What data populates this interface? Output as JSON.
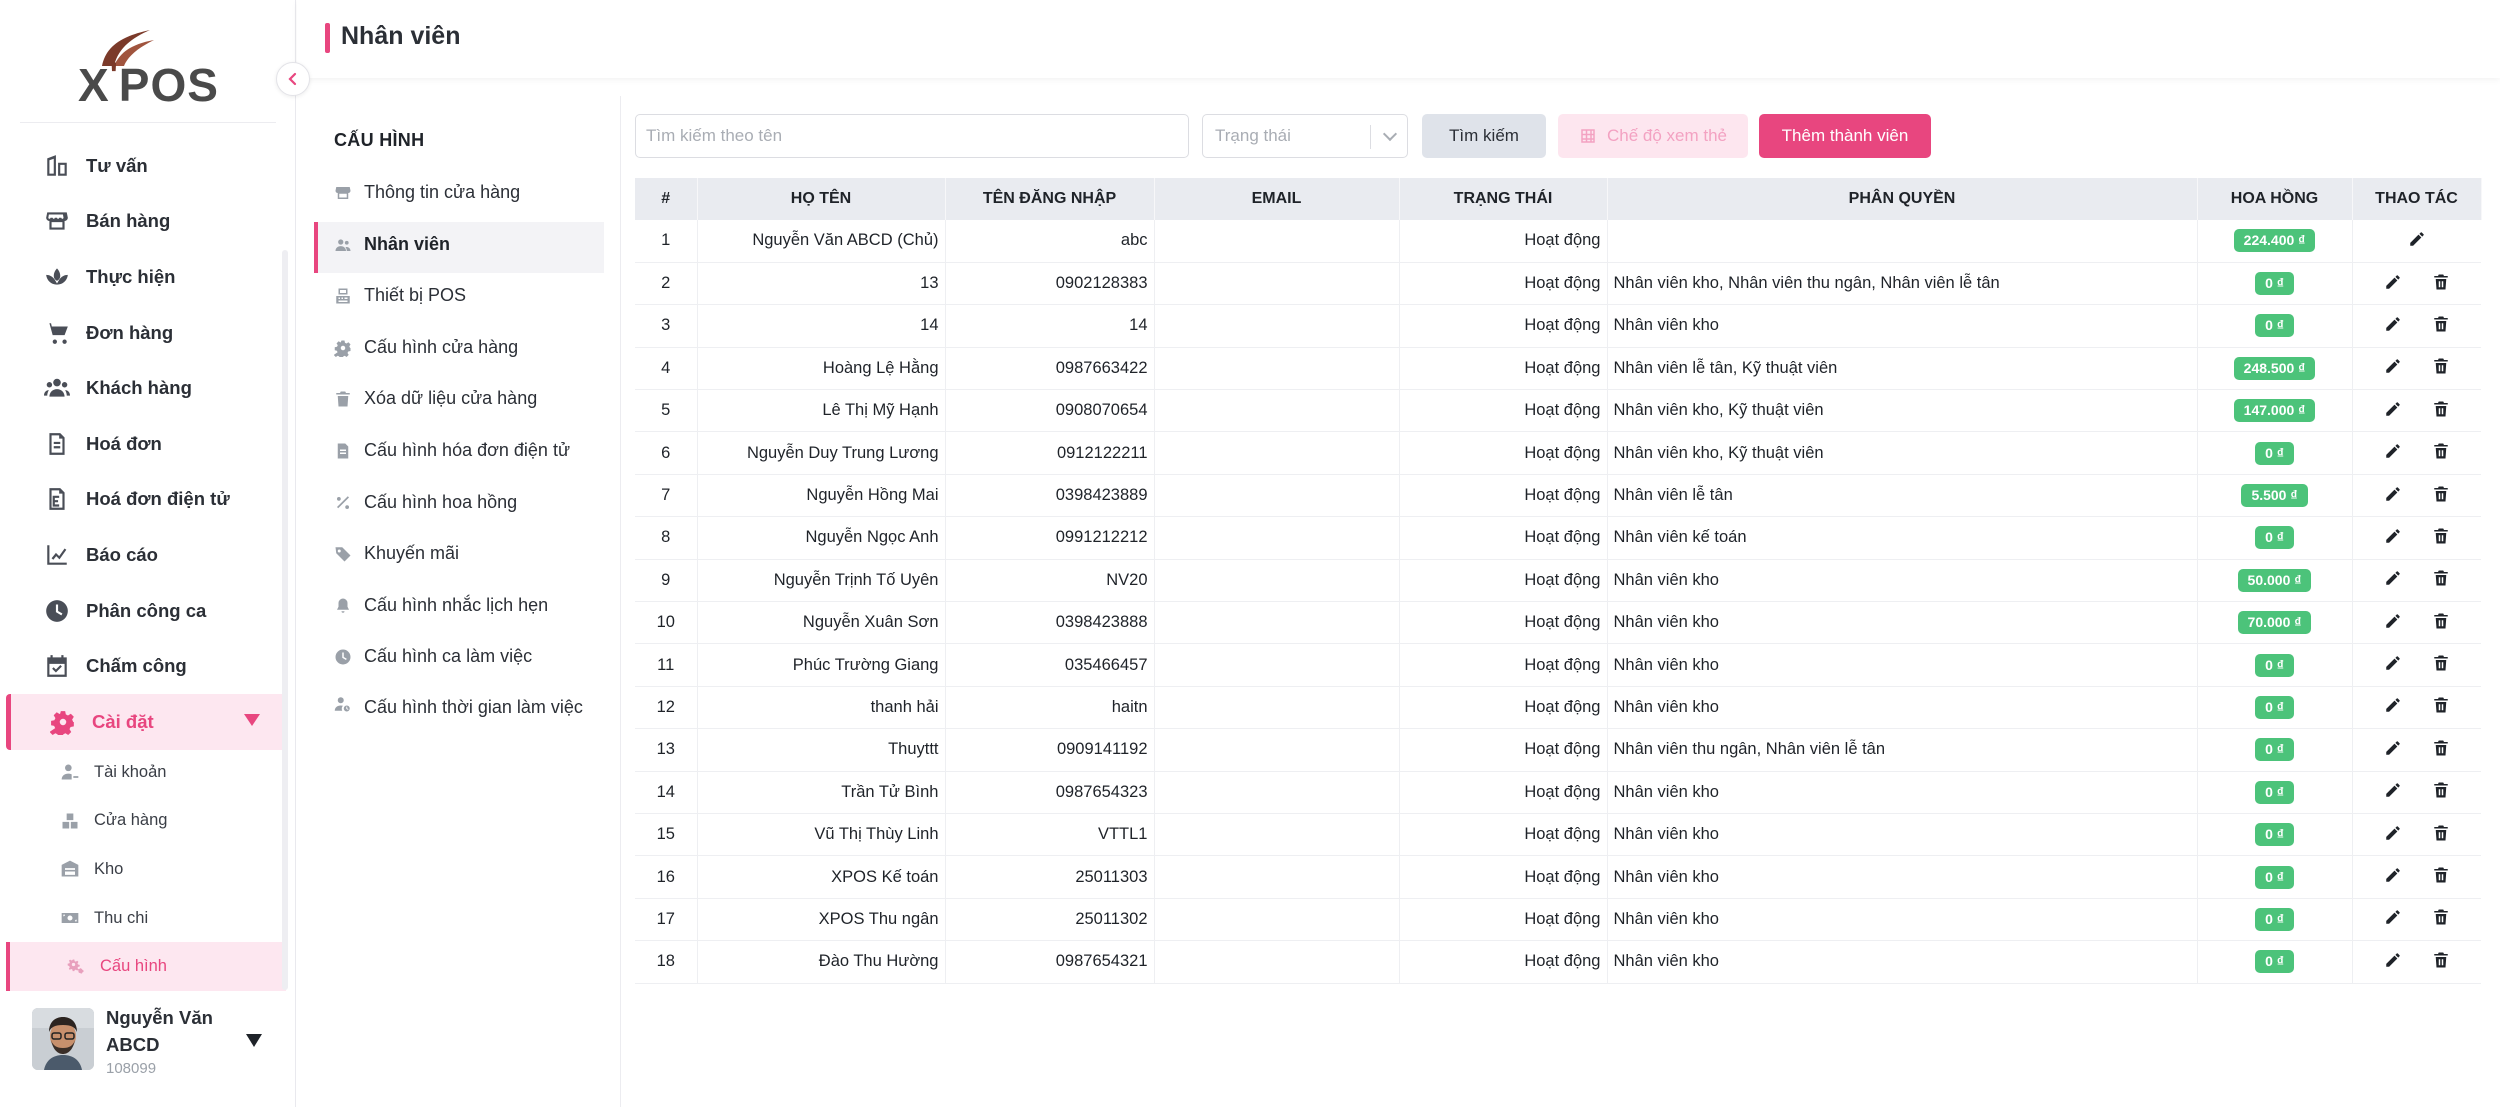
{
  "brand": {
    "name": "X'POS",
    "letter": "X",
    "apostrophe": "'",
    "rest": "POS"
  },
  "header": {
    "title": "Nhân viên"
  },
  "sidebar": {
    "items": [
      {
        "label": "Tư vấn",
        "icon": "consult-icon"
      },
      {
        "label": "Bán hàng",
        "icon": "store-icon"
      },
      {
        "label": "Thực hiện",
        "icon": "lotus-icon"
      },
      {
        "label": "Đơn hàng",
        "icon": "cart-icon"
      },
      {
        "label": "Khách hàng",
        "icon": "users-icon"
      },
      {
        "label": "Hoá đơn",
        "icon": "invoice-icon"
      },
      {
        "label": "Hoá đơn điện tử",
        "icon": "e-invoice-icon"
      },
      {
        "label": "Báo cáo",
        "icon": "chart-icon"
      },
      {
        "label": "Phân công ca",
        "icon": "clock-icon"
      },
      {
        "label": "Chấm công",
        "icon": "calendar-check-icon"
      },
      {
        "label": "Cài đặt",
        "icon": "gear-icon"
      }
    ],
    "sub_items": [
      {
        "label": "Tài khoản",
        "icon": "account-icon"
      },
      {
        "label": "Cửa hàng",
        "icon": "shop-icon"
      },
      {
        "label": "Kho",
        "icon": "warehouse-icon"
      },
      {
        "label": "Thu chi",
        "icon": "money-icon"
      },
      {
        "label": "Cấu hình",
        "icon": "cogs-icon"
      }
    ],
    "active_item": "Cài đặt",
    "active_sub_item": "Cấu hình"
  },
  "user": {
    "name": "Nguyễn Văn ABCD",
    "code": "108099"
  },
  "config": {
    "title": "CẤU HÌNH",
    "items": [
      {
        "label": "Thông tin cửa hàng",
        "icon": "store-info-icon"
      },
      {
        "label": "Nhân viên",
        "icon": "staff-icon"
      },
      {
        "label": "Thiết bị POS",
        "icon": "pos-device-icon"
      },
      {
        "label": "Cấu hình cửa hàng",
        "icon": "gear-icon"
      },
      {
        "label": "Xóa dữ liệu cửa hàng",
        "icon": "trash-icon"
      },
      {
        "label": "Cấu hình hóa đơn điện tử",
        "icon": "document-icon"
      },
      {
        "label": "Cấu hình hoa hồng",
        "icon": "percent-icon"
      },
      {
        "label": "Khuyến mãi",
        "icon": "tag-icon"
      },
      {
        "label": "Cấu hình nhắc lịch hẹn",
        "icon": "bell-icon"
      },
      {
        "label": "Cấu hình ca làm việc",
        "icon": "clock-icon"
      },
      {
        "label": "Cấu hình thời gian làm việc",
        "icon": "user-clock-icon"
      }
    ],
    "active": "Nhân viên"
  },
  "toolbar": {
    "search_placeholder": "Tìm kiếm theo tên",
    "status_placeholder": "Trạng thái",
    "search_button": "Tìm kiếm",
    "card_view_button": "Chế độ xem thẻ",
    "add_button": "Thêm thành viên"
  },
  "table": {
    "columns": [
      "#",
      "HỌ TÊN",
      "TÊN ĐĂNG NHẬP",
      "EMAIL",
      "TRẠNG THÁI",
      "PHÂN QUYỀN",
      "HOA HỒNG",
      "THAO TÁC"
    ],
    "rows": [
      {
        "idx": "1",
        "name": "Nguyễn Văn ABCD (Chủ)",
        "username": "abc",
        "email": "",
        "status": "Hoạt động",
        "role": "",
        "commission": "224.400 ₫",
        "deletable": false
      },
      {
        "idx": "2",
        "name": "13",
        "username": "0902128383",
        "email": "",
        "status": "Hoạt động",
        "role": "Nhân viên kho, Nhân viên thu ngân, Nhân viên lễ tân",
        "commission": "0 ₫",
        "deletable": true
      },
      {
        "idx": "3",
        "name": "14",
        "username": "14",
        "email": "",
        "status": "Hoạt động",
        "role": "Nhân viên kho",
        "commission": "0 ₫",
        "deletable": true
      },
      {
        "idx": "4",
        "name": "Hoàng Lệ Hằng",
        "username": "0987663422",
        "email": "",
        "status": "Hoạt động",
        "role": "Nhân viên lễ tân, Kỹ thuật viên",
        "commission": "248.500 ₫",
        "deletable": true
      },
      {
        "idx": "5",
        "name": "Lê Thị Mỹ Hạnh",
        "username": "0908070654",
        "email": "",
        "status": "Hoạt động",
        "role": "Nhân viên kho, Kỹ thuật viên",
        "commission": "147.000 ₫",
        "deletable": true
      },
      {
        "idx": "6",
        "name": "Nguyễn Duy Trung Lương",
        "username": "0912122211",
        "email": "",
        "status": "Hoạt động",
        "role": "Nhân viên kho, Kỹ thuật viên",
        "commission": "0 ₫",
        "deletable": true
      },
      {
        "idx": "7",
        "name": "Nguyễn Hồng Mai",
        "username": "0398423889",
        "email": "",
        "status": "Hoạt động",
        "role": "Nhân viên lễ tân",
        "commission": "5.500 ₫",
        "deletable": true
      },
      {
        "idx": "8",
        "name": "Nguyễn Ngọc Anh",
        "username": "0991212212",
        "email": "",
        "status": "Hoạt động",
        "role": "Nhân viên kế toán",
        "commission": "0 ₫",
        "deletable": true
      },
      {
        "idx": "9",
        "name": "Nguyễn Trịnh Tố Uyên",
        "username": "NV20",
        "email": "",
        "status": "Hoạt động",
        "role": "Nhân viên kho",
        "commission": "50.000 ₫",
        "deletable": true
      },
      {
        "idx": "10",
        "name": "Nguyễn Xuân Sơn",
        "username": "0398423888",
        "email": "",
        "status": "Hoạt động",
        "role": "Nhân viên kho",
        "commission": "70.000 ₫",
        "deletable": true
      },
      {
        "idx": "11",
        "name": "Phúc Trường Giang",
        "username": "035466457",
        "email": "",
        "status": "Hoạt động",
        "role": "Nhân viên kho",
        "commission": "0 ₫",
        "deletable": true
      },
      {
        "idx": "12",
        "name": "thanh hải",
        "username": "haitn",
        "email": "",
        "status": "Hoạt động",
        "role": "Nhân viên kho",
        "commission": "0 ₫",
        "deletable": true
      },
      {
        "idx": "13",
        "name": "Thuyttt",
        "username": "0909141192",
        "email": "",
        "status": "Hoạt động",
        "role": "Nhân viên thu ngân, Nhân viên lễ tân",
        "commission": "0 ₫",
        "deletable": true
      },
      {
        "idx": "14",
        "name": "Trần Tử Bình",
        "username": "0987654323",
        "email": "",
        "status": "Hoạt động",
        "role": "Nhân viên kho",
        "commission": "0 ₫",
        "deletable": true
      },
      {
        "idx": "15",
        "name": "Vũ Thị Thùy Linh",
        "username": "VTTL1",
        "email": "",
        "status": "Hoạt động",
        "role": "Nhân viên kho",
        "commission": "0 ₫",
        "deletable": true
      },
      {
        "idx": "16",
        "name": "XPOS Kế toán",
        "username": "25011303",
        "email": "",
        "status": "Hoạt động",
        "role": "Nhân viên kho",
        "commission": "0 ₫",
        "deletable": true
      },
      {
        "idx": "17",
        "name": "XPOS Thu ngân",
        "username": "25011302",
        "email": "",
        "status": "Hoạt động",
        "role": "Nhân viên kho",
        "commission": "0 ₫",
        "deletable": true
      },
      {
        "idx": "18",
        "name": "Đào Thu Hường",
        "username": "0987654321",
        "email": "",
        "status": "Hoạt động",
        "role": "Nhân viên kho",
        "commission": "0 ₫",
        "deletable": true
      }
    ]
  },
  "colors": {
    "accent": "#e8467f",
    "accent_soft": "#fde7f0",
    "badge": "#4cc37a",
    "table_header": "#e9ebf0"
  }
}
